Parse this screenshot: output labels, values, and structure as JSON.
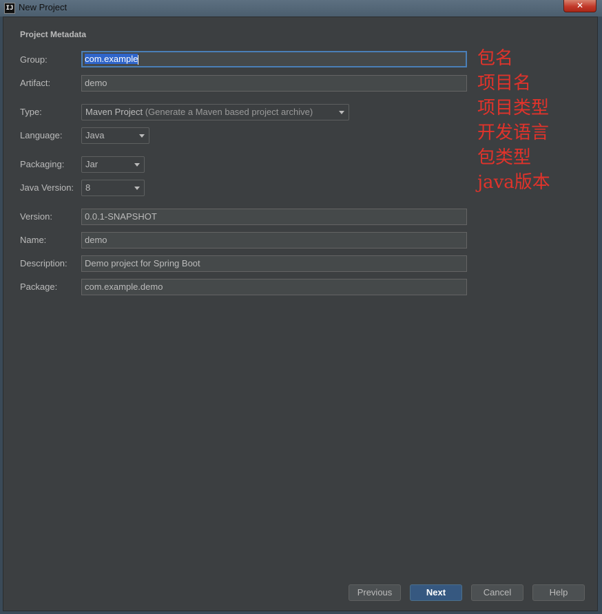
{
  "window": {
    "title": "New Project",
    "app_icon_text": "IJ",
    "close_glyph": "✕"
  },
  "section_title": "Project Metadata",
  "fields": {
    "group": {
      "label": "Group:",
      "value": "com.example"
    },
    "artifact": {
      "label": "Artifact:",
      "value": "demo"
    },
    "type": {
      "label": "Type:",
      "value": "Maven Project",
      "hint": "(Generate a Maven based project archive)"
    },
    "language": {
      "label": "Language:",
      "value": "Java"
    },
    "packaging": {
      "label": "Packaging:",
      "value": "Jar"
    },
    "java_version": {
      "label": "Java Version:",
      "value": "8"
    },
    "version": {
      "label": "Version:",
      "value": "0.0.1-SNAPSHOT"
    },
    "name": {
      "label": "Name:",
      "value": "demo"
    },
    "description": {
      "label": "Description:",
      "value": "Demo project for Spring Boot"
    },
    "package": {
      "label": "Package:",
      "value": "com.example.demo"
    }
  },
  "annotations": [
    "包名",
    "项目名",
    "项目类型",
    "开发语言",
    "包类型",
    "java版本"
  ],
  "buttons": {
    "previous": "Previous",
    "next": "Next",
    "cancel": "Cancel",
    "help": "Help"
  },
  "colors": {
    "dialog_bg": "#3c3f41",
    "input_bg": "#45494a",
    "focus_border": "#4a7fb8",
    "primary_button": "#365880",
    "annotation_red": "#e0332b"
  }
}
